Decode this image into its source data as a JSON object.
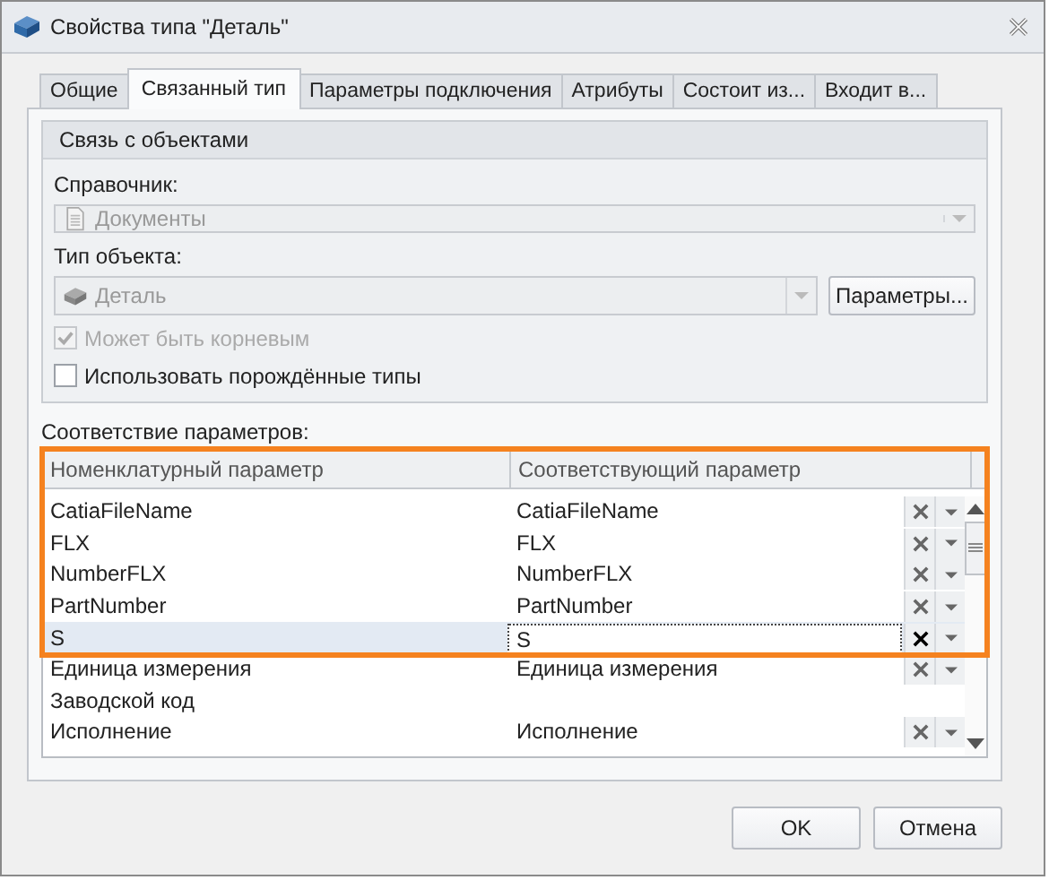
{
  "window": {
    "title": "Свойства типа \"Деталь\""
  },
  "tabs": [
    {
      "label": "Общие",
      "selected": false
    },
    {
      "label": "Связанный тип",
      "selected": true
    },
    {
      "label": "Параметры подключения",
      "selected": false
    },
    {
      "label": "Атрибуты",
      "selected": false
    },
    {
      "label": "Состоит из...",
      "selected": false
    },
    {
      "label": "Входит в...",
      "selected": false
    }
  ],
  "group": {
    "title": "Связь с объектами",
    "directory": {
      "label": "Справочник:",
      "value": "Документы",
      "disabled": true
    },
    "object_type": {
      "label": "Тип объекта:",
      "value": "Деталь",
      "disabled": true,
      "button": "Параметры..."
    },
    "checkboxes": [
      {
        "label": "Может быть корневым",
        "checked": true,
        "disabled": true
      },
      {
        "label": "Использовать порождённые типы",
        "checked": false,
        "disabled": false
      }
    ]
  },
  "mapping": {
    "label": "Соответствие параметров:",
    "columns": [
      "Номенклатурный параметр",
      "Соответствующий параметр"
    ],
    "rows": [
      {
        "name": "CatiaFileName",
        "match": "CatiaFileName",
        "editable": true,
        "selected": false
      },
      {
        "name": "FLX",
        "match": "FLX",
        "editable": true,
        "selected": false
      },
      {
        "name": "NumberFLX",
        "match": "NumberFLX",
        "editable": true,
        "selected": false
      },
      {
        "name": "PartNumber",
        "match": "PartNumber",
        "editable": true,
        "selected": false
      },
      {
        "name": "S",
        "match": "S",
        "editable": true,
        "selected": true
      },
      {
        "name": "Единица измерения",
        "match": "Единица измерения",
        "editable": true,
        "selected": false
      },
      {
        "name": "Заводской код",
        "editable": false,
        "selected": false
      },
      {
        "name": "Исполнение",
        "match": "Исполнение",
        "editable": true,
        "selected": false
      }
    ],
    "highlighted": true
  },
  "buttons": [
    "OK",
    "Отмена"
  ]
}
